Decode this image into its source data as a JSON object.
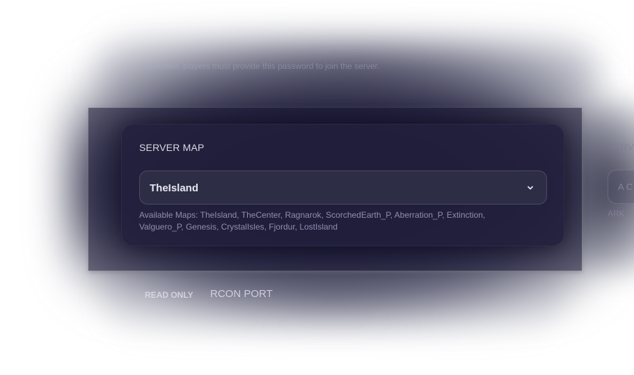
{
  "background_hint": {
    "password_help": "If specified, players must provide this password to join the server."
  },
  "server_map": {
    "label": "SERVER MAP",
    "selected": "TheIsland",
    "help": "Available Maps: TheIsland, TheCenter, Ragnarok, ScorchedEarth_P, Aberration_P, Extinction, Valguero_P, Genesis, CrystalIsles, Fjordur, LostIsland"
  },
  "right_column": {
    "label": "SERV",
    "input_value": "A C",
    "help": "ARK"
  },
  "bottom": {
    "read_only_badge": "READ ONLY",
    "rcon_port_label": "RCON PORT"
  },
  "icons": {
    "select_chevron": "chevron-down-icon"
  },
  "colors": {
    "card_bg": "#22203c",
    "select_bg": "#2e2d46",
    "label_text": "#d9d9e6",
    "helper_text": "#aaaacd"
  }
}
